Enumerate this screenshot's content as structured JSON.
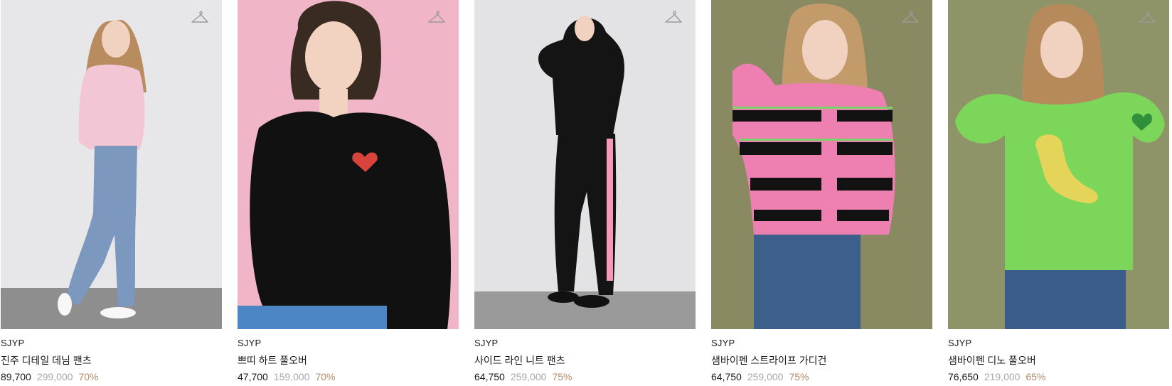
{
  "products": [
    {
      "brand": "SJYP",
      "name": "진주 디테일 데님 팬츠",
      "sale_price": "89,700",
      "original_price": "299,000",
      "discount": "70%",
      "wishlist_icon": "hanger-icon",
      "colors": {
        "background": "#e6e6e8",
        "floor": "#8c8c8c",
        "top": "#f3c6d6",
        "bottom": "#7c98bf",
        "skin": "#f1d2c0",
        "hair": "#b88c5e"
      }
    },
    {
      "brand": "SJYP",
      "name": "쁘띠 하트 풀오버",
      "sale_price": "47,700",
      "original_price": "159,000",
      "discount": "70%",
      "wishlist_icon": "hanger-icon",
      "colors": {
        "background": "#f0b5c7",
        "top": "#111111",
        "bottom": "#4d86c4",
        "skin": "#f2d2c0",
        "hair": "#3a2b22",
        "accent": "#d8443c"
      }
    },
    {
      "brand": "SJYP",
      "name": "사이드 라인 니트 팬츠",
      "sale_price": "64,750",
      "original_price": "259,000",
      "discount": "75%",
      "wishlist_icon": "hanger-icon",
      "colors": {
        "background": "#e3e3e5",
        "floor": "#999999",
        "top": "#141414",
        "bottom": "#141414",
        "stripe": "#f29ab8",
        "skin": "#f1d2c0",
        "hair": "#7d5a3c"
      }
    },
    {
      "brand": "SJYP",
      "name": "샘바이펜 스트라이프 가디건",
      "sale_price": "64,750",
      "original_price": "259,000",
      "discount": "75%",
      "wishlist_icon": "hanger-icon",
      "colors": {
        "background": "#8a8a62",
        "top": "#ee7fb1",
        "stripe": "#121212",
        "bottom": "#3c5f8c",
        "skin": "#f1d2c0",
        "hair": "#c39a6a",
        "accent": "#79d36a"
      }
    },
    {
      "brand": "SJYP",
      "name": "샘바이펜 디노 풀오버",
      "sale_price": "76,650",
      "original_price": "219,000",
      "discount": "65%",
      "wishlist_icon": "hanger-icon",
      "colors": {
        "background": "#8f9368",
        "top": "#7bd65a",
        "bottom": "#3b5d8c",
        "skin": "#f1d2c0",
        "hair": "#b68a5a",
        "accent": "#e4d55a"
      }
    }
  ]
}
